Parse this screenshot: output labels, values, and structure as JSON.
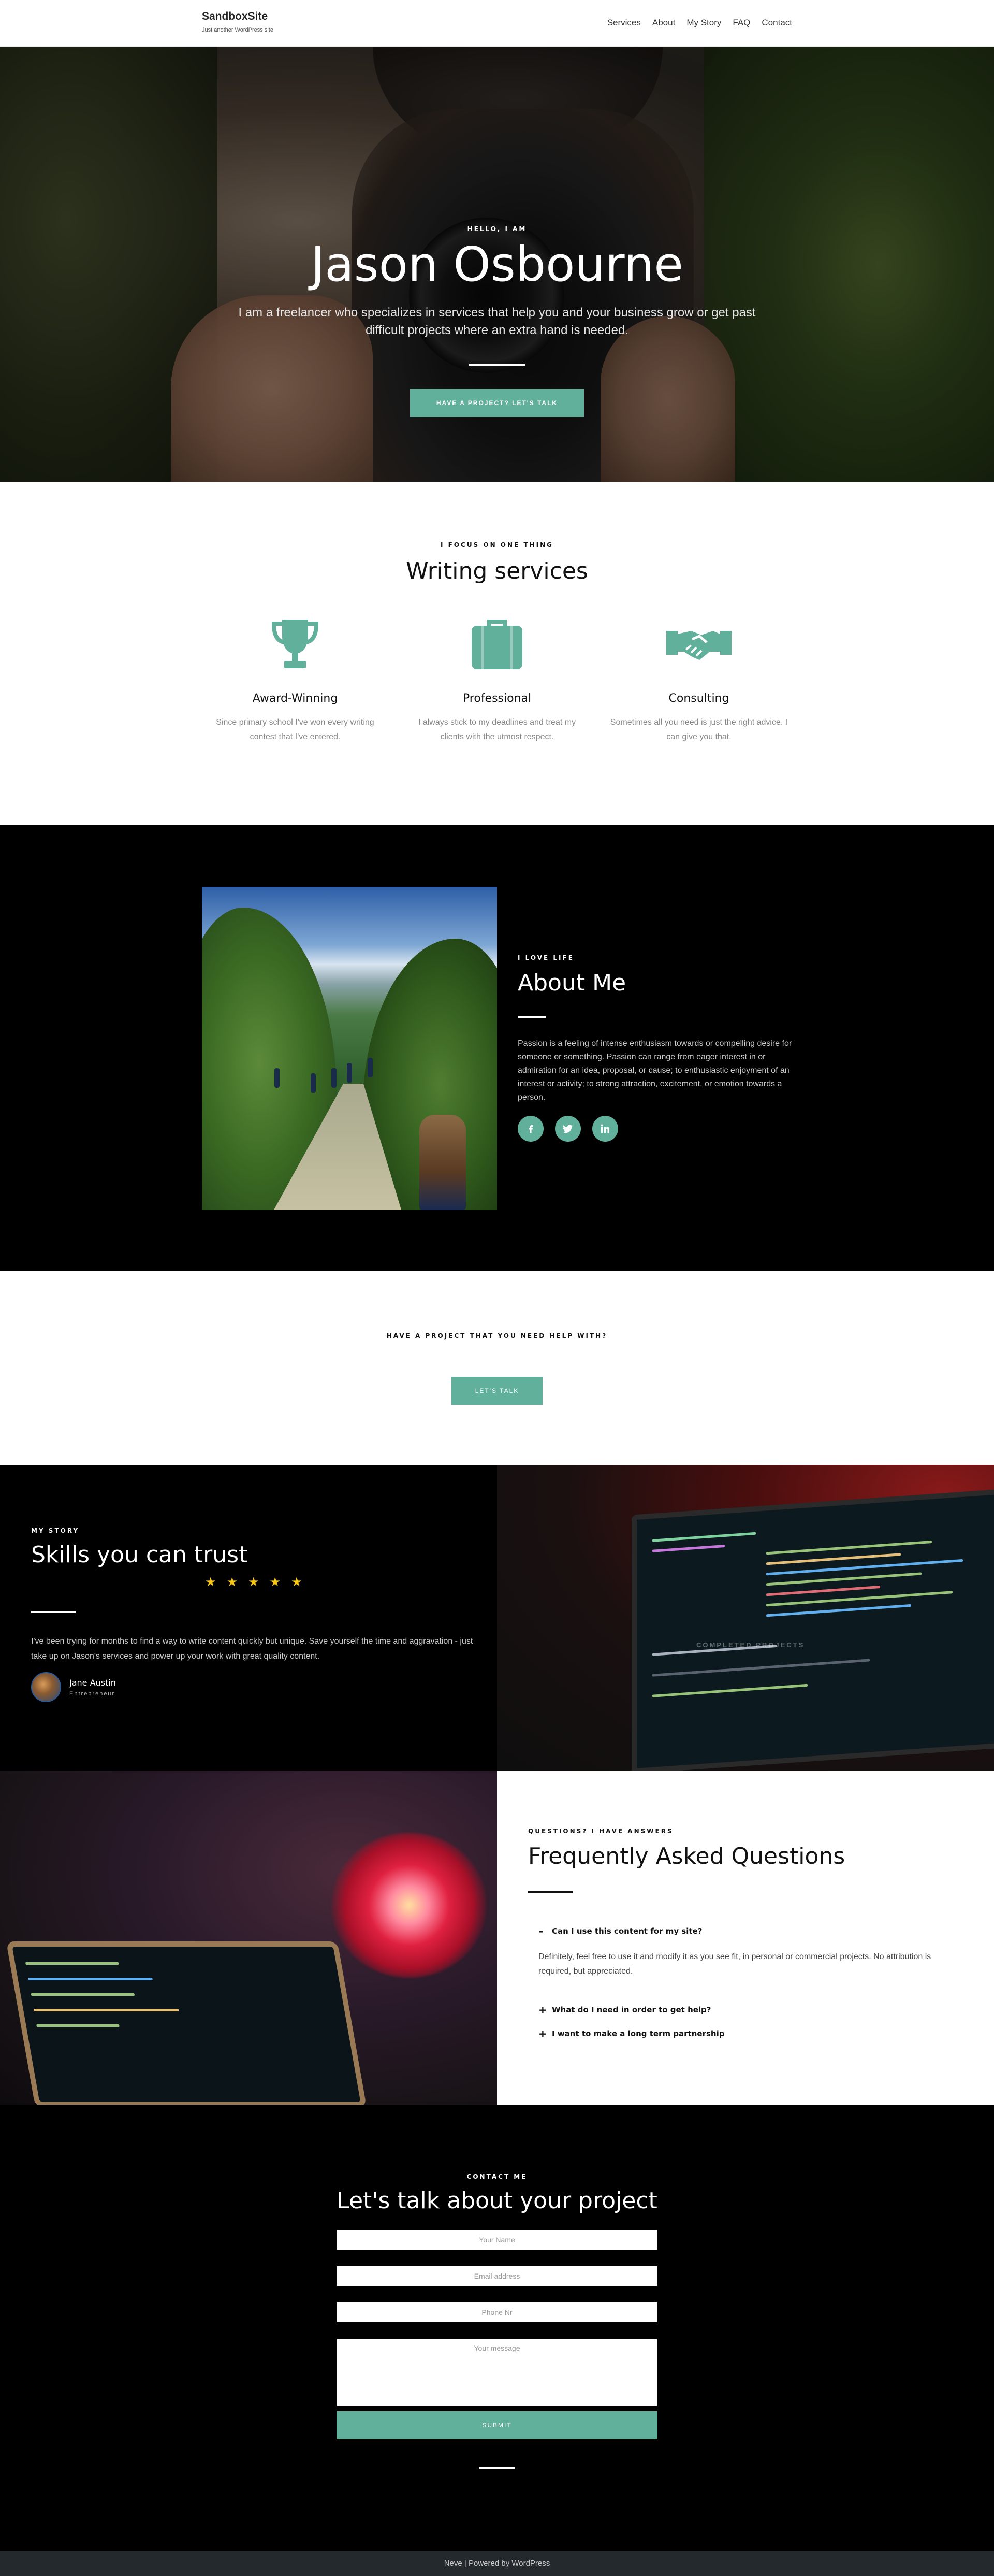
{
  "header": {
    "site_title": "SandboxSite",
    "tagline": "Just another WordPress site",
    "nav": [
      {
        "label": "Services"
      },
      {
        "label": "About"
      },
      {
        "label": "My Story"
      },
      {
        "label": "FAQ"
      },
      {
        "label": "Contact"
      }
    ]
  },
  "hero": {
    "kicker": "HELLO, I AM",
    "title": "Jason Osbourne",
    "subtitle": "I am a freelancer who specializes in services that help you and your business grow or get past difficult projects where an extra hand is needed.",
    "button": "HAVE A PROJECT? LET'S TALK"
  },
  "services": {
    "kicker": "I FOCUS ON ONE THING",
    "title": "Writing services",
    "items": [
      {
        "icon": "trophy-icon",
        "title": "Award-Winning",
        "text": "Since primary school I've won every writing contest that I've entered."
      },
      {
        "icon": "briefcase-icon",
        "title": "Professional",
        "text": "I always stick to my deadlines and treat my clients with the utmost respect."
      },
      {
        "icon": "handshake-icon",
        "title": "Consulting",
        "text": "Sometimes all you need is just the right advice. I can give you that."
      }
    ]
  },
  "about": {
    "kicker": "I LOVE LIFE",
    "title": "About Me",
    "text": "Passion is a feeling of intense enthusiasm towards or compelling desire for someone or something. Passion can range from eager interest in or admiration for an idea, proposal, or cause; to enthusiastic enjoyment of an interest or activity; to strong attraction, excitement, or emotion towards a person.",
    "socials": [
      "facebook-icon",
      "twitter-icon",
      "linkedin-icon"
    ]
  },
  "cta": {
    "text": "HAVE A PROJECT THAT YOU NEED HELP WITH?",
    "button": "LET'S TALK"
  },
  "story": {
    "kicker": "MY STORY",
    "title": "Skills you can trust",
    "stars": 5,
    "quote": "I've been trying for months to find a way to write content quickly but unique. Save yourself the time and aggravation - just take up on Jason's services and power up your work with great quality content.",
    "author_name": "Jane Austin",
    "author_role": "Entrepreneur",
    "image_caption": "COMPLETED PROJECTS"
  },
  "faq": {
    "kicker": "QUESTIONS? I HAVE ANSWERS",
    "title": "Frequently Asked Questions",
    "items": [
      {
        "q": "Can I use this content for my site?",
        "open": true,
        "a": "Definitely, feel free to use it and modify it as you see fit, in personal or commercial projects. No attribution is required, but appreciated."
      },
      {
        "q": "What do I need in order to get help?",
        "open": false
      },
      {
        "q": "I want to make a long term partnership",
        "open": false
      }
    ]
  },
  "contact": {
    "kicker": "CONTACT ME",
    "title": "Let's talk about your project",
    "name_placeholder": "Your Name",
    "email_placeholder": "Email address",
    "phone_placeholder": "Phone Nr",
    "message_placeholder": "Your message",
    "submit": "SUBMIT"
  },
  "footer": {
    "theme": "Neve",
    "separator": "|",
    "powered": "Powered by WordPress"
  },
  "colors": {
    "accent": "#61b09b",
    "dark": "#000000",
    "footer": "#24292e",
    "star": "#f5c518"
  }
}
